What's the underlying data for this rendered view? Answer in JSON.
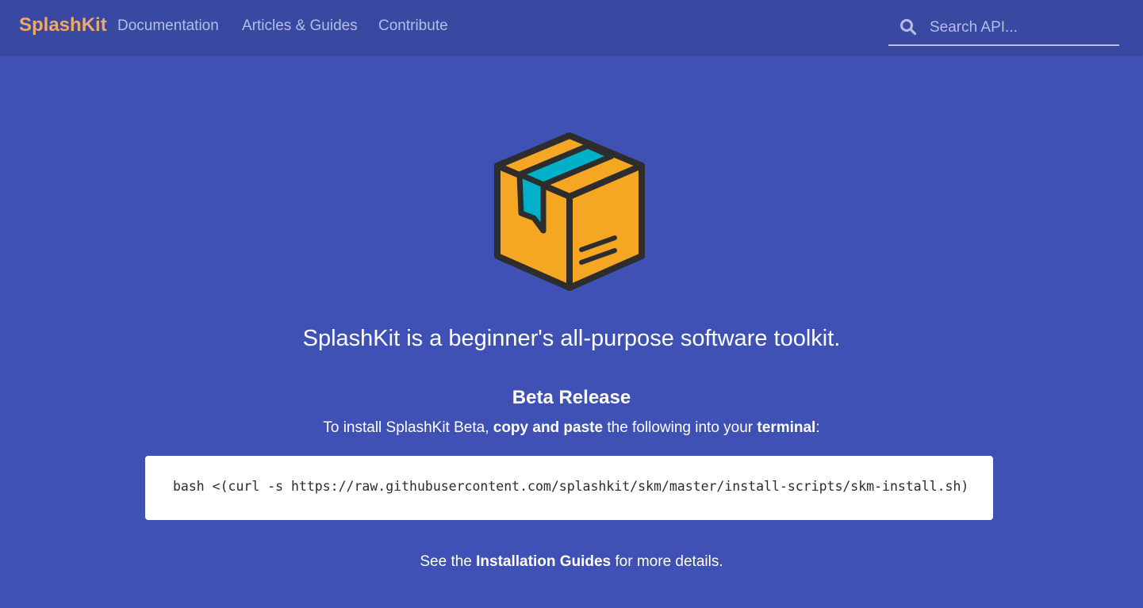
{
  "nav": {
    "brand": "SplashKit",
    "links": [
      "Documentation",
      "Articles & Guides",
      "Contribute"
    ],
    "search": {
      "placeholder": "Search API...",
      "value": ""
    }
  },
  "hero": {
    "icon": "package-box-icon",
    "tagline": "SplashKit is a beginner's all-purpose software toolkit."
  },
  "beta": {
    "title": "Beta Release",
    "install_prefix": "To install SplashKit Beta, ",
    "install_bold1": "copy and paste",
    "install_mid": " the following into your ",
    "install_bold2": "terminal",
    "install_suffix": ":",
    "command": "bash <(curl -s https://raw.githubusercontent.com/splashkit/skm/master/install-scripts/skm-install.sh)"
  },
  "details": {
    "prefix": "See the ",
    "link": "Installation Guides",
    "suffix": " for more details."
  },
  "colors": {
    "background": "#3f51b5",
    "navbar": "#3949a2",
    "brand": "#f0a868",
    "nav_link": "#b5bde6",
    "box_orange": "#f5a623",
    "tape_teal": "#00b0c8",
    "outline": "#2d2d2d"
  }
}
